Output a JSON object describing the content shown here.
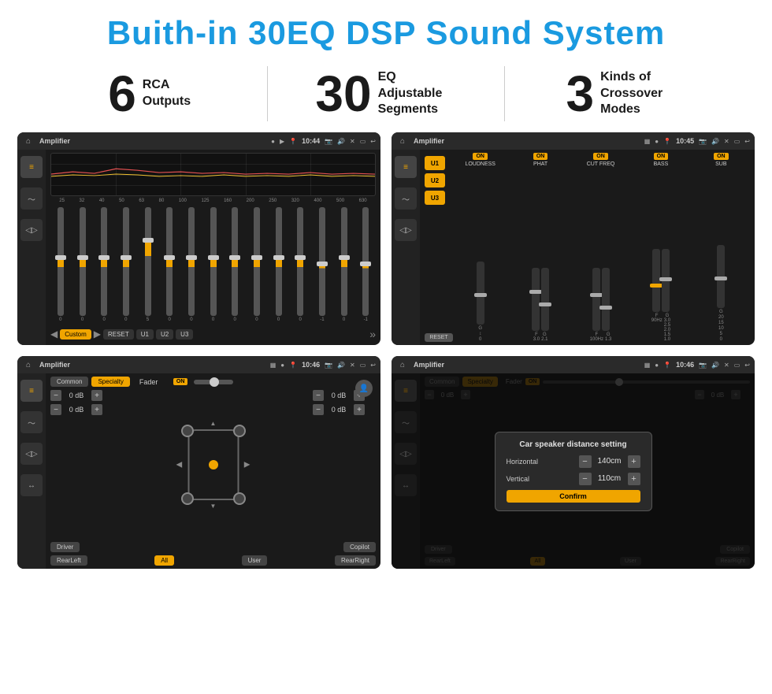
{
  "header": {
    "title": "Buith-in 30EQ DSP Sound System"
  },
  "stats": [
    {
      "number": "6",
      "label": "RCA\nOutputs"
    },
    {
      "number": "30",
      "label": "EQ Adjustable\nSegments"
    },
    {
      "number": "3",
      "label": "Kinds of\nCrossover Modes"
    }
  ],
  "screens": [
    {
      "id": "screen-eq",
      "topbar": {
        "title": "Amplifier",
        "time": "10:44"
      }
    },
    {
      "id": "screen-amp",
      "topbar": {
        "title": "Amplifier",
        "time": "10:45"
      }
    },
    {
      "id": "screen-fader",
      "topbar": {
        "title": "Amplifier",
        "time": "10:46"
      }
    },
    {
      "id": "screen-dialog",
      "topbar": {
        "title": "Amplifier",
        "time": "10:46"
      },
      "dialog": {
        "title": "Car speaker distance setting",
        "horizontal_label": "Horizontal",
        "horizontal_value": "140cm",
        "vertical_label": "Vertical",
        "vertical_value": "110cm",
        "confirm_label": "Confirm"
      }
    }
  ],
  "eq_screen": {
    "freq_labels": [
      "25",
      "32",
      "40",
      "50",
      "63",
      "80",
      "100",
      "125",
      "160",
      "200",
      "250",
      "320",
      "400",
      "500",
      "630"
    ],
    "values": [
      "0",
      "0",
      "0",
      "0",
      "5",
      "0",
      "0",
      "0",
      "0",
      "0",
      "0",
      "0",
      "-1",
      "0",
      "-1"
    ],
    "buttons": [
      "Custom",
      "RESET",
      "U1",
      "U2",
      "U3"
    ]
  },
  "amp_screen": {
    "presets": [
      "U1",
      "U2",
      "U3"
    ],
    "channels": [
      {
        "label": "LOUDNESS",
        "on": true
      },
      {
        "label": "PHAT",
        "on": true
      },
      {
        "label": "CUT FREQ",
        "on": true
      },
      {
        "label": "BASS",
        "on": true
      },
      {
        "label": "SUB",
        "on": true
      }
    ],
    "reset_label": "RESET"
  },
  "fader_screen": {
    "tabs": [
      "Common",
      "Specialty"
    ],
    "active_tab": "Specialty",
    "fader_label": "Fader",
    "fader_on": "ON",
    "buttons": {
      "driver": "Driver",
      "copilot": "Copilot",
      "rear_left": "RearLeft",
      "all": "All",
      "user": "User",
      "rear_right": "RearRight"
    },
    "vol_values": [
      "0 dB",
      "0 dB",
      "0 dB",
      "0 dB"
    ]
  },
  "dialog_screen": {
    "tabs": [
      "Common",
      "Specialty"
    ],
    "active_tab": "Specialty",
    "fader_on": "ON",
    "dialog": {
      "title": "Car speaker distance setting",
      "horizontal_label": "Horizontal",
      "horizontal_value": "140cm",
      "vertical_label": "Vertical",
      "vertical_value": "110cm",
      "confirm_label": "Confirm"
    },
    "buttons": {
      "driver": "Driver",
      "copilot": "Copilot",
      "rear_left": "RearLeft...",
      "all": "All",
      "user": "User",
      "rear_right": "RearRight"
    },
    "side_labels": [
      "0 dB",
      "0 dB"
    ]
  }
}
